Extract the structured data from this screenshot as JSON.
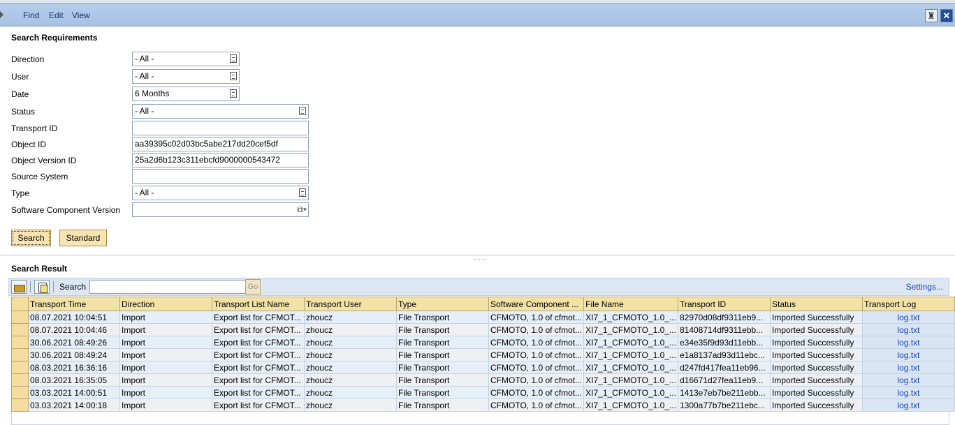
{
  "menu": {
    "find": "Find",
    "edit": "Edit",
    "view": "View"
  },
  "search_requirements": {
    "title": "Search Requirements",
    "fields": {
      "direction": {
        "label": "Direction",
        "value": "- All -"
      },
      "user": {
        "label": "User",
        "value": "- All -"
      },
      "date": {
        "label": "Date",
        "value": "6 Months"
      },
      "status": {
        "label": "Status",
        "value": "- All -"
      },
      "transport_id": {
        "label": "Transport ID",
        "value": ""
      },
      "object_id": {
        "label": "Object ID",
        "value": "aa39395c02d03bc5abe217dd20cef5df"
      },
      "object_version_id": {
        "label": "Object Version ID",
        "value": "25a2d6b123c311ebcfd9000000543472"
      },
      "source_system": {
        "label": "Source System",
        "value": ""
      },
      "type": {
        "label": "Type",
        "value": "- All -"
      },
      "software_component_version": {
        "label": "Software Component Version",
        "value": ""
      }
    },
    "buttons": {
      "search": "Search",
      "standard": "Standard"
    }
  },
  "search_result": {
    "title": "Search Result",
    "toolbar": {
      "search_label": "Search",
      "search_value": "",
      "go_label": "Go",
      "settings_label": "Settings..."
    },
    "columns": [
      "Transport Time",
      "Direction",
      "Transport List Name",
      "Transport User",
      "Type",
      "Software Component ...",
      "File Name",
      "Transport ID",
      "Status",
      "Transport Log"
    ],
    "rows": [
      [
        "08.07.2021 10:04:51",
        "Import",
        "Export list for CFMOT...",
        "zhoucz",
        "File Transport",
        "CFMOTO, 1.0 of cfmot...",
        "XI7_1_CFMOTO_1.0_...",
        "82970d08df9311eb9...",
        "Imported Successfully",
        "log.txt"
      ],
      [
        "08.07.2021 10:04:46",
        "Import",
        "Export list for CFMOT...",
        "zhoucz",
        "File Transport",
        "CFMOTO, 1.0 of cfmot...",
        "XI7_1_CFMOTO_1.0_...",
        "81408714df9311ebb...",
        "Imported Successfully",
        "log.txt"
      ],
      [
        "30.06.2021 08:49:26",
        "Import",
        "Export list for CFMOT...",
        "zhoucz",
        "File Transport",
        "CFMOTO, 1.0 of cfmot...",
        "XI7_1_CFMOTO_1.0_...",
        "e34e35f9d93d11ebb...",
        "Imported Successfully",
        "log.txt"
      ],
      [
        "30.06.2021 08:49:24",
        "Import",
        "Export list for CFMOT...",
        "zhoucz",
        "File Transport",
        "CFMOTO, 1.0 of cfmot...",
        "XI7_1_CFMOTO_1.0_...",
        "e1a8137ad93d11ebc...",
        "Imported Successfully",
        "log.txt"
      ],
      [
        "08.03.2021 16:36:16",
        "Import",
        "Export list for CFMOT...",
        "zhoucz",
        "File Transport",
        "CFMOTO, 1.0 of cfmot...",
        "XI7_1_CFMOTO_1.0_...",
        "d247fd417fea11eb96...",
        "Imported Successfully",
        "log.txt"
      ],
      [
        "08.03.2021 16:35:05",
        "Import",
        "Export list for CFMOT...",
        "zhoucz",
        "File Transport",
        "CFMOTO, 1.0 of cfmot...",
        "XI7_1_CFMOTO_1.0_...",
        "d16671d27fea11eb9...",
        "Imported Successfully",
        "log.txt"
      ],
      [
        "03.03.2021 14:00:51",
        "Import",
        "Export list for CFMOT...",
        "zhoucz",
        "File Transport",
        "CFMOTO, 1.0 of cfmot...",
        "XI7_1_CFMOTO_1.0_...",
        "1413e7eb7be211ebb...",
        "Imported Successfully",
        "log.txt"
      ],
      [
        "03.03.2021 14:00:18",
        "Import",
        "Export list for CFMOT...",
        "zhoucz",
        "File Transport",
        "CFMOTO, 1.0 of cfmot...",
        "XI7_1_CFMOTO_1.0_...",
        "1300a77b7be211ebc...",
        "Imported Successfully",
        "log.txt"
      ]
    ]
  },
  "icons": {
    "window_pin": "pin-icon",
    "window_close": "close-icon",
    "dropdown": "dropdown-list-icon",
    "value_help": "value-help-icon",
    "toolbar_open": "folder-icon",
    "toolbar_copy": "copy-icon"
  },
  "colors": {
    "menubar": "#a8c2e4",
    "header_cell": "#f3e2a6",
    "button": "#f7e4b0",
    "link": "#1846b8",
    "row_odd": "#e6eef8",
    "row_even": "#eef0f4"
  }
}
